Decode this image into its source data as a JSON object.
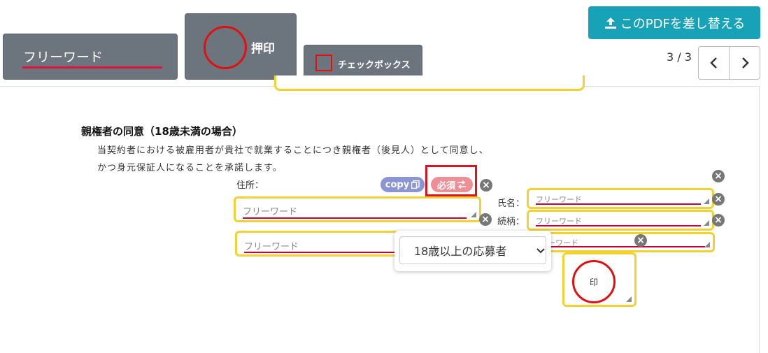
{
  "toolbar": {
    "freeword_label": "フリーワード",
    "stamp_label": "押印",
    "checkbox_label": "チェックボックス",
    "replace_pdf_label": "このPDFを差し替える"
  },
  "pagination": {
    "indicator": "3 / 3"
  },
  "document": {
    "section_title": "親権者の同意（18歳未満の場合）",
    "paragraph_line1": "当契約者における被雇用者が貴社で就業することにつき親権者（後見人）として同意し、",
    "paragraph_line2": "かつ身元保証人になることを承諾します。",
    "address_label": "住所：",
    "name_label": "氏名：",
    "relation_label": "続柄：",
    "fields": {
      "address1_placeholder": "フリーワード",
      "address2_placeholder": "フリーワード",
      "name_placeholder": "フリーワード",
      "relation_placeholder": "フリーワード",
      "extra_placeholder": "ーワード"
    },
    "stamp_text": "印"
  },
  "field_controls": {
    "copy_label": "copy",
    "required_label": "必須"
  },
  "popover": {
    "selected_option": "18歳以上の応募者"
  },
  "colors": {
    "toolbar_gray": "#6c757d",
    "accent_teal": "#17a2b8",
    "field_yellow": "#f2d133",
    "underline_red": "#c8003a",
    "stamp_red": "#e01010",
    "copy_badge": "#8b95d6",
    "required_badge": "#ee8f96"
  }
}
